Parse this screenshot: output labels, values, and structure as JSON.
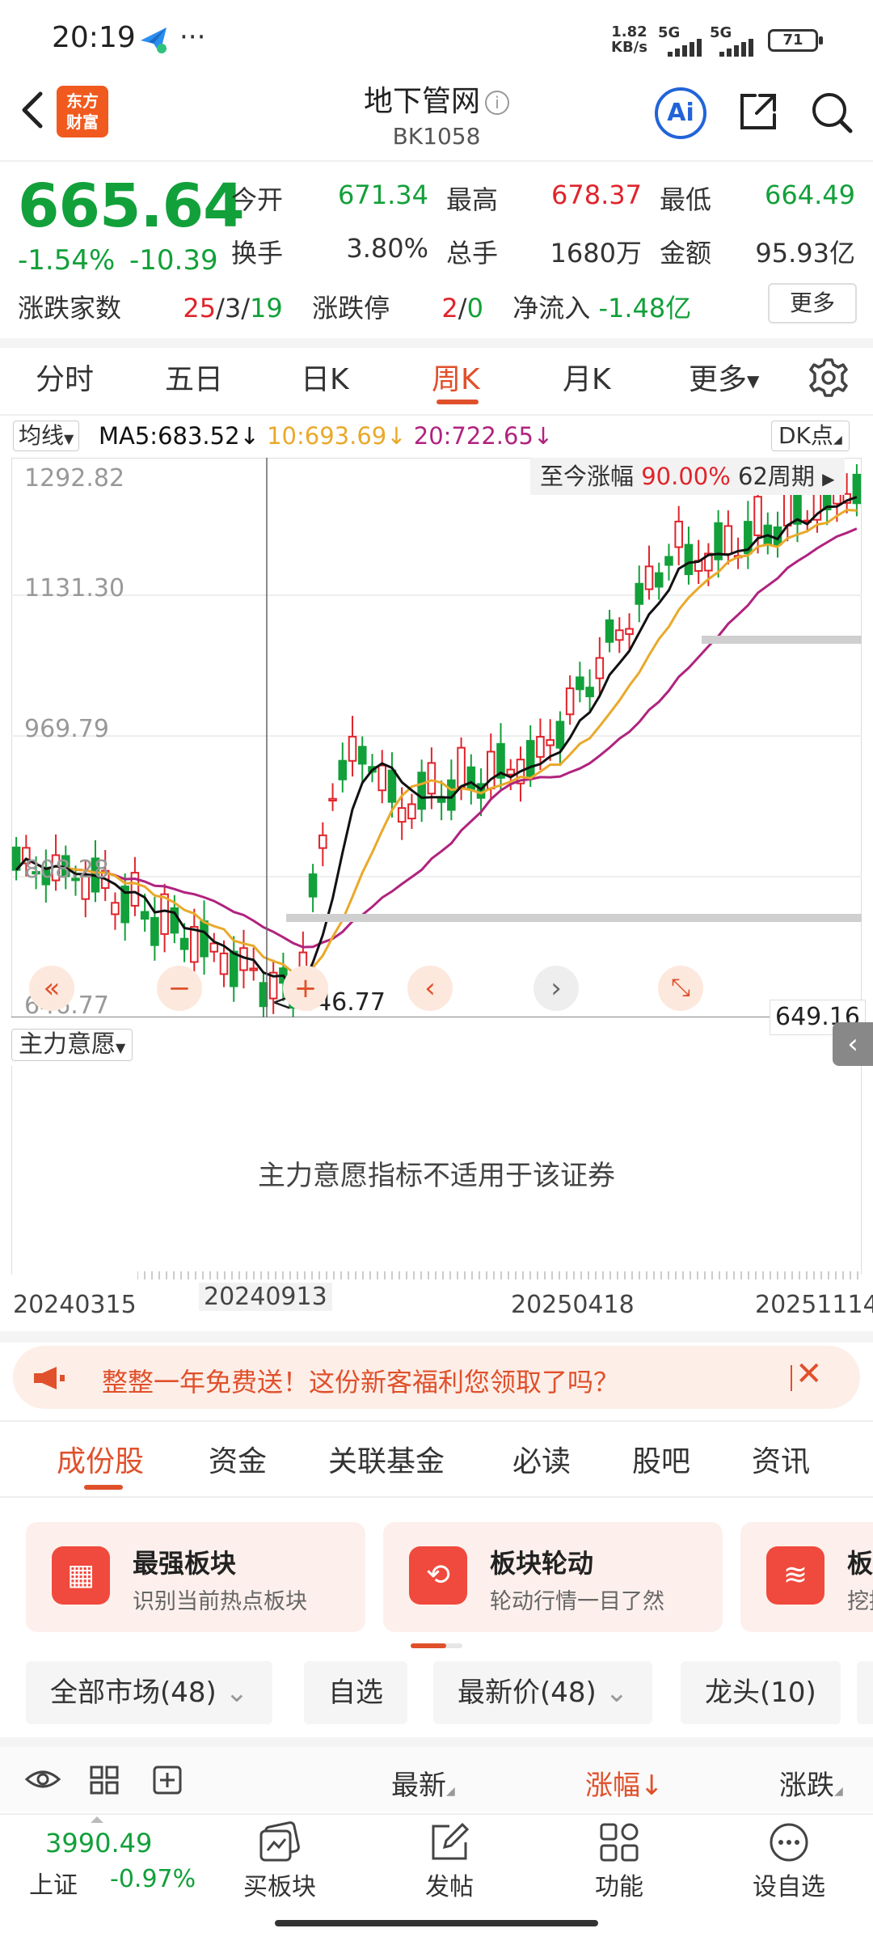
{
  "status": {
    "time": "20:19",
    "dots": "···",
    "net_speed_value": "1.82",
    "net_speed_unit": "KB/s",
    "sig1": "5G",
    "sig2": "5G",
    "battery": "71"
  },
  "header": {
    "logo_line1": "东方",
    "logo_line2": "财富",
    "title": "地下管网",
    "code": "BK1058",
    "ai_label": "Ai"
  },
  "quote": {
    "price": "665.64",
    "change_pct": "-1.54%",
    "change_abs": "-10.39",
    "open_label": "今开",
    "open": "671.34",
    "high_label": "最高",
    "high": "678.37",
    "low_label": "最低",
    "low": "664.49",
    "turnover_label": "换手",
    "turnover": "3.80%",
    "volume_label": "总手",
    "volume": "1680万",
    "amount_label": "金额",
    "amount": "95.93亿",
    "breadth_label": "涨跌家数",
    "breadth_up": "25",
    "breadth_flat": "3",
    "breadth_down": "19",
    "limit_label": "涨跌停",
    "limit_up": "2",
    "limit_down": "0",
    "netflow_label": "净流入",
    "netflow": "-1.48亿",
    "more": "更多"
  },
  "tabs": [
    "分时",
    "五日",
    "日K",
    "周K",
    "月K",
    "更多"
  ],
  "ma": {
    "select": "均线",
    "ma5": "MA5:683.52↓",
    "ma10": "10:693.69↓",
    "ma20": "20:722.65↓",
    "dk": "DK点",
    "color_ma5": "#111111",
    "color_ma10": "#e9a92a",
    "color_ma20": "#b0237f"
  },
  "chart": {
    "y_labels": [
      "1292.82",
      "1131.30",
      "969.79",
      "808.28",
      "646.77"
    ],
    "range_label": "至今涨幅",
    "range_pct": "90.00%",
    "range_periods": "62周期",
    "min_label": "646.77",
    "right_price": "649.16",
    "up_color": "#e0242b",
    "down_color": "#12a03a"
  },
  "chart_data": {
    "type": "candlestick",
    "ylim": [
      646.77,
      1292.82
    ],
    "y_ticks": [
      1292.82,
      1131.3,
      969.79,
      808.28,
      646.77
    ],
    "x_labels": [
      "20240315",
      "20240913",
      "20250418",
      "20251114"
    ],
    "markers": {
      "min": 646.77,
      "current": 649.16
    },
    "series": [
      {
        "name": "MA5",
        "value": 683.52
      },
      {
        "name": "10",
        "value": 693.69
      },
      {
        "name": "20",
        "value": 722.65
      }
    ]
  },
  "indicator": {
    "select": "主力意愿",
    "message": "主力意愿指标不适用于该证券"
  },
  "dates": [
    "20240315",
    "20240913",
    "20250418",
    "20251114"
  ],
  "promo": {
    "text": "整整一年免费送！这份新客福利您领取了吗？"
  },
  "subtabs": [
    "成份股",
    "资金",
    "关联基金",
    "必读",
    "股吧",
    "资讯"
  ],
  "cards": [
    {
      "title": "最强板块",
      "sub": "识别当前热点板块"
    },
    {
      "title": "板块轮动",
      "sub": "轮动行情一目了然"
    },
    {
      "title": "板块",
      "sub": "挖掘"
    }
  ],
  "filters": [
    "全部市场(48)",
    "自选",
    "最新价(48)",
    "龙头(10)"
  ],
  "list_header": {
    "latest": "最新",
    "change_pct": "涨幅↓",
    "change": "涨跌"
  },
  "bottom": {
    "index_value": "3990.49",
    "index_name": "上证",
    "index_chg": "-0.97%",
    "items": [
      "买板块",
      "发帖",
      "功能",
      "设自选"
    ]
  }
}
